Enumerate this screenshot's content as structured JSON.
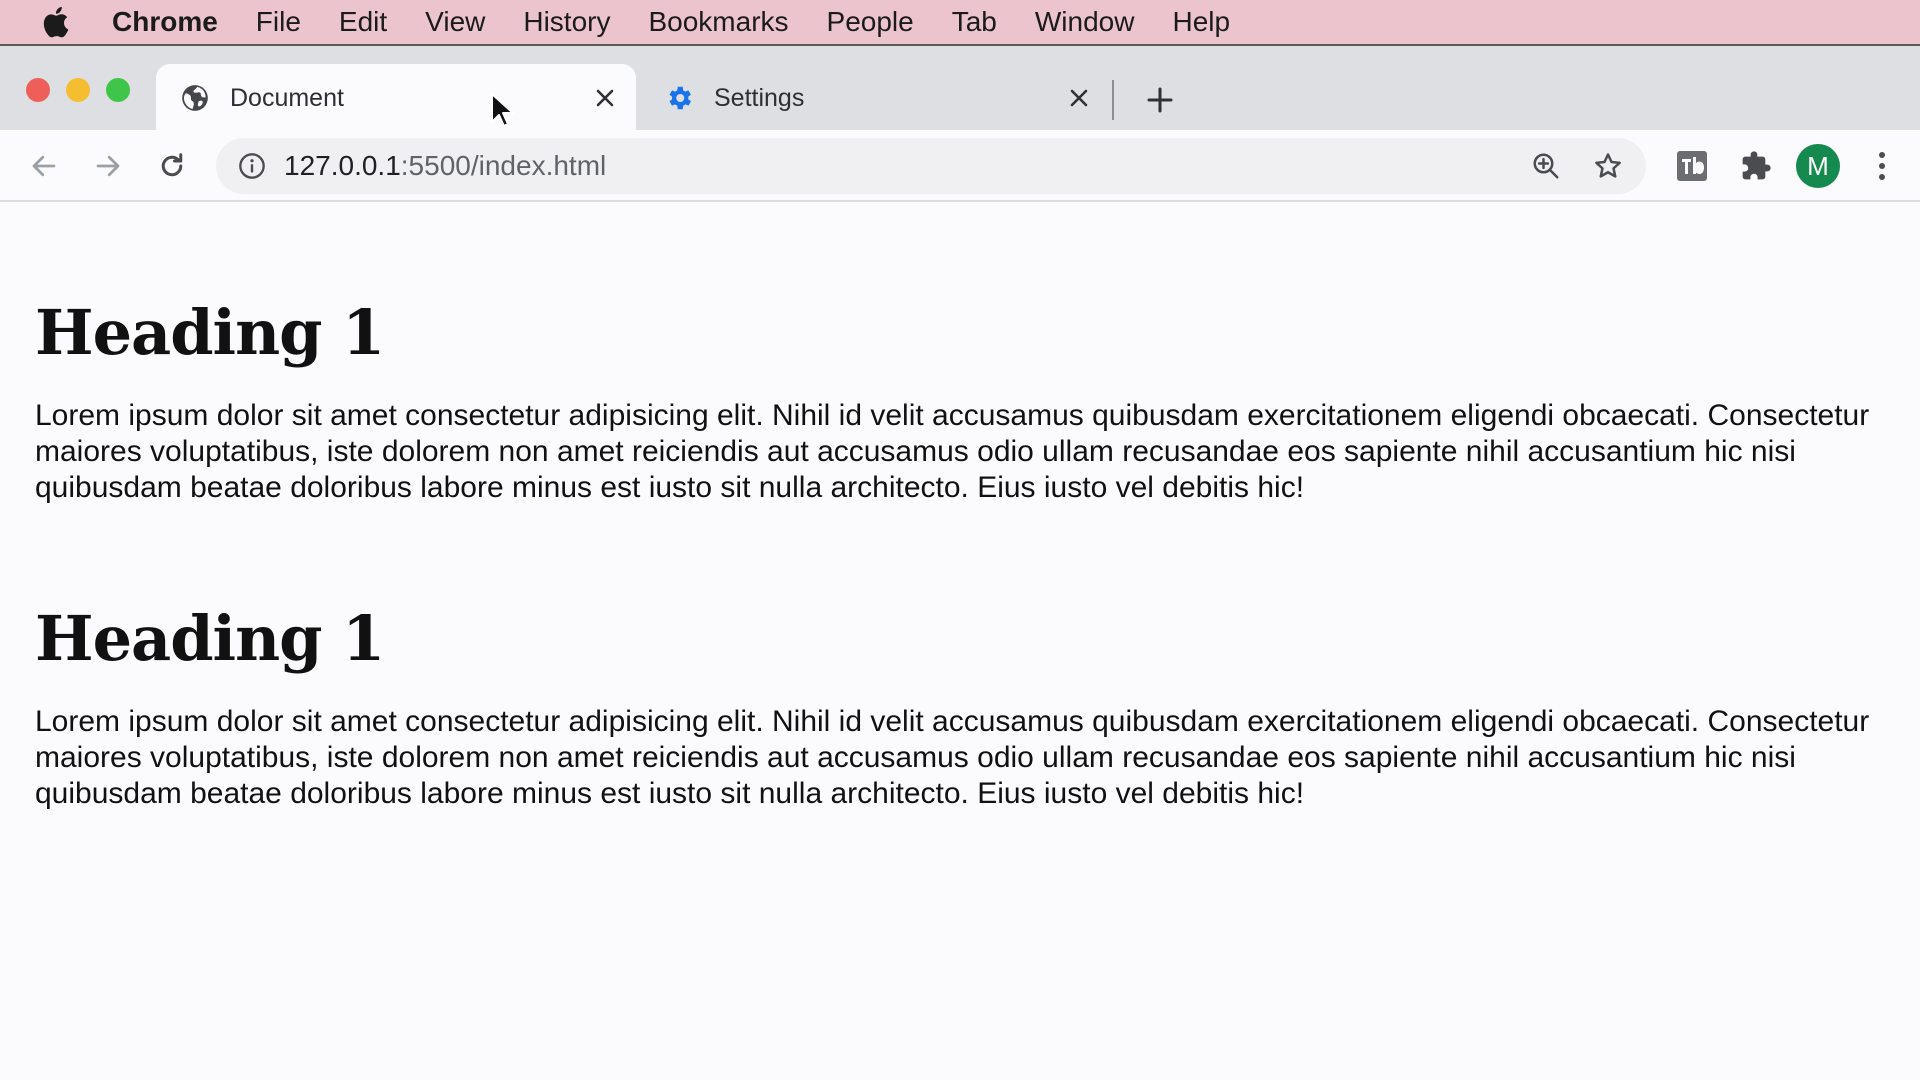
{
  "menubar": {
    "app_name": "Chrome",
    "items": [
      "File",
      "Edit",
      "View",
      "History",
      "Bookmarks",
      "People",
      "Tab",
      "Window",
      "Help"
    ]
  },
  "tabs": [
    {
      "title": "Document",
      "icon": "globe-icon",
      "active": true
    },
    {
      "title": "Settings",
      "icon": "gear-icon",
      "active": false
    }
  ],
  "toolbar": {
    "url_host": "127.0.0.1",
    "url_rest": ":5500/index.html",
    "avatar_letter": "M"
  },
  "page": {
    "sections": [
      {
        "heading": "Heading 1",
        "paragraph": "Lorem ipsum dolor sit amet consectetur adipisicing elit. Nihil id velit accusamus quibusdam exercitationem eligendi obcaecati. Consectetur maiores voluptatibus, iste dolorem non amet reiciendis aut accusamus odio ullam recusandae eos sapiente nihil accusantium hic nisi quibusdam beatae doloribus labore minus est iusto sit nulla architecto. Eius iusto vel debitis hic!"
      },
      {
        "heading": "Heading 1",
        "paragraph": "Lorem ipsum dolor sit amet consectetur adipisicing elit. Nihil id velit accusamus quibusdam exercitationem eligendi obcaecati. Consectetur maiores voluptatibus, iste dolorem non amet reiciendis aut accusamus odio ullam recusandae eos sapiente nihil accusantium hic nisi quibusdam beatae doloribus labore minus est iusto sit nulla architecto. Eius iusto vel debitis hic!"
      }
    ]
  },
  "colors": {
    "menubar_bg": "#ecc4cd",
    "tabstrip_bg": "#dedfe3",
    "settings_gear": "#1a73e8",
    "avatar_bg": "#148a4e"
  }
}
